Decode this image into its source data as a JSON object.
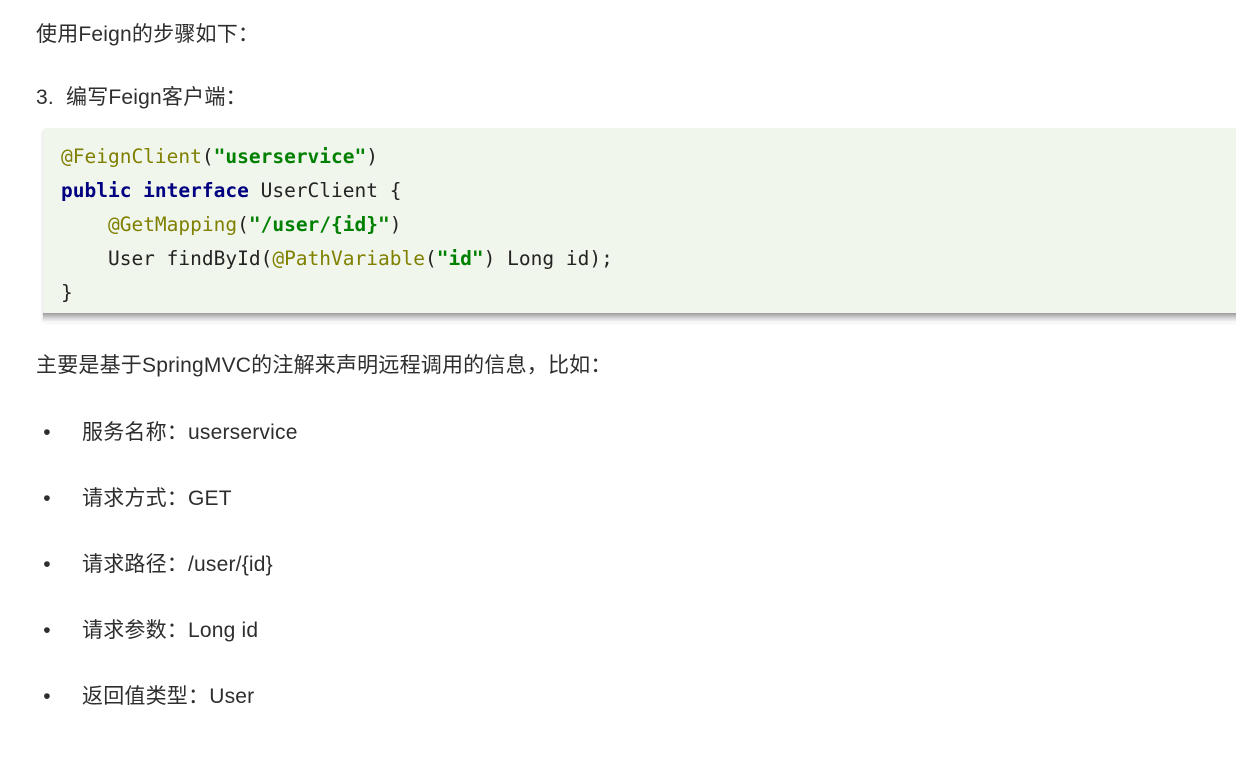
{
  "document": {
    "intro_paragraph": "使用Feign的步骤如下：",
    "step": {
      "number": "3.",
      "text": "编写Feign客户端："
    },
    "code_block": {
      "language": "java",
      "background_color": "#f1f6ed",
      "colors": {
        "annotation": "#808000",
        "keyword": "#000080",
        "string": "#008000",
        "plain": "#232323"
      },
      "lines": [
        {
          "tokens": [
            {
              "type": "annotation",
              "text": "@FeignClient"
            },
            {
              "type": "plain",
              "text": "("
            },
            {
              "type": "string",
              "text": "\"userservice\""
            },
            {
              "type": "plain",
              "text": ")"
            }
          ]
        },
        {
          "tokens": [
            {
              "type": "keyword",
              "text": "public interface"
            },
            {
              "type": "plain",
              "text": " UserClient {"
            }
          ]
        },
        {
          "tokens": [
            {
              "type": "plain",
              "text": "    "
            },
            {
              "type": "annotation",
              "text": "@GetMapping"
            },
            {
              "type": "plain",
              "text": "("
            },
            {
              "type": "string",
              "text": "\"/user/{id}\""
            },
            {
              "type": "plain",
              "text": ")"
            }
          ]
        },
        {
          "tokens": [
            {
              "type": "plain",
              "text": "    User findById("
            },
            {
              "type": "annotation",
              "text": "@PathVariable"
            },
            {
              "type": "plain",
              "text": "("
            },
            {
              "type": "string",
              "text": "\"id\""
            },
            {
              "type": "plain",
              "text": ") Long id);"
            }
          ]
        },
        {
          "tokens": [
            {
              "type": "plain",
              "text": "}"
            }
          ]
        }
      ]
    },
    "body_paragraph": "主要是基于SpringMVC的注解来声明远程调用的信息，比如：",
    "bullets": [
      {
        "marker": "•",
        "label": "服务名称：",
        "value": "userservice",
        "text": "服务名称：userservice"
      },
      {
        "marker": "•",
        "label": "请求方式：",
        "value": "GET",
        "text": "请求方式：GET"
      },
      {
        "marker": "•",
        "label": "请求路径：",
        "value": "/user/{id}",
        "text": "请求路径：/user/{id}"
      },
      {
        "marker": "•",
        "label": "请求参数：",
        "value": "Long id",
        "text": "请求参数：Long id"
      },
      {
        "marker": "•",
        "label": "返回值类型：",
        "value": "User",
        "text": "返回值类型：User"
      }
    ]
  }
}
